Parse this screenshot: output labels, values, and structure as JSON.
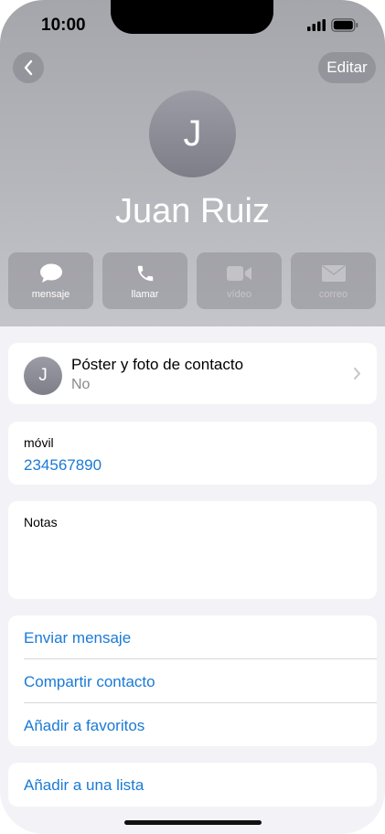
{
  "status_bar": {
    "time": "10:00"
  },
  "nav": {
    "edit_label": "Editar"
  },
  "contact": {
    "initial": "J",
    "name": "Juan Ruiz"
  },
  "actions": [
    {
      "label": "mensaje",
      "enabled": true,
      "icon": "message-bubble-icon"
    },
    {
      "label": "llamar",
      "enabled": true,
      "icon": "phone-icon"
    },
    {
      "label": "vídeo",
      "enabled": false,
      "icon": "video-icon"
    },
    {
      "label": "correo",
      "enabled": false,
      "icon": "mail-icon"
    }
  ],
  "poster": {
    "initial": "J",
    "title": "Póster y foto de contacto",
    "value": "No"
  },
  "phone_field": {
    "label": "móvil",
    "value": "234567890"
  },
  "notes": {
    "label": "Notas"
  },
  "links": {
    "send_message": "Enviar mensaje",
    "share_contact": "Compartir contacto",
    "add_favorites": "Añadir a favoritos",
    "add_to_list": "Añadir a una lista"
  },
  "colors": {
    "link": "#1a7ad6",
    "background": "#f2f2f7"
  }
}
